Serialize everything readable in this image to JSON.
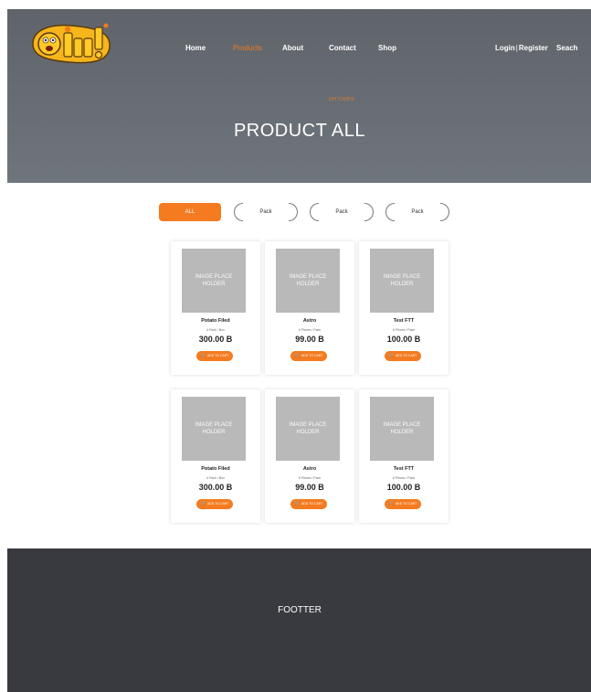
{
  "brand": {
    "logo_text": "Ohhh!"
  },
  "nav": {
    "items": [
      {
        "label": "Home"
      },
      {
        "label": "Products"
      },
      {
        "label": "About"
      },
      {
        "label": "Contact"
      },
      {
        "label": "Shop"
      }
    ],
    "login": "Login",
    "separator": "|",
    "register": "Register",
    "search": "Seach"
  },
  "hero": {
    "kicker": "OH CHIPS",
    "title": "PRODUCT ALL"
  },
  "filters": {
    "all": "ALL",
    "pills": [
      "Pack",
      "Pack",
      "Pack"
    ]
  },
  "products": [
    {
      "image_label": "IMAGE PLACE HOLDER",
      "name": "Potato Filed",
      "unit": "4 Pack / Box",
      "price": "300.00 B",
      "button": "ADD TO CART"
    },
    {
      "image_label": "IMAGE PLACE HOLDER",
      "name": "Astro",
      "unit": "6 Pieces / Pack",
      "price": "99.00 B",
      "button": "ADD TO CART"
    },
    {
      "image_label": "IMAGE PLACE HOLDER",
      "name": "Test FTT",
      "unit": "6 Pieces / Pack",
      "price": "100.00 B",
      "button": "ADD TO CART"
    },
    {
      "image_label": "IMAGE PLACE HOLDER",
      "name": "Potato Filed",
      "unit": "4 Pack / Box",
      "price": "300.00 B",
      "button": "ADD TO CART"
    },
    {
      "image_label": "IMAGE PLACE HOLDER",
      "name": "Astro",
      "unit": "6 Pieces / Pack",
      "price": "99.00 B",
      "button": "ADD TO CART"
    },
    {
      "image_label": "IMAGE PLACE HOLDER",
      "name": "Test FTT",
      "unit": "6 Pieces / Pack",
      "price": "100.00 B",
      "button": "ADD TO CART"
    }
  ],
  "footer": {
    "label": "FOOTTER"
  },
  "colors": {
    "accent": "#f47b20",
    "hero_bg": "#676c73",
    "footer_bg": "#383a3f"
  },
  "icons": {
    "cart": "cart-icon"
  }
}
